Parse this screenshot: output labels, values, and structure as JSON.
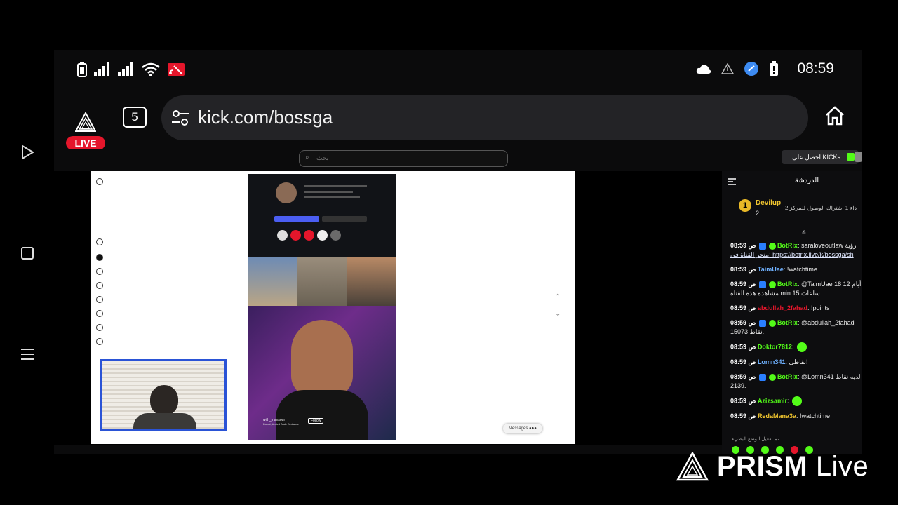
{
  "status_bar": {
    "time": "08:59",
    "left_icons": [
      "battery-icon",
      "signal-icon",
      "signal-icon-2",
      "wifi-icon",
      "cast-icon"
    ],
    "right_icons": [
      "cloud-icon",
      "warning-icon",
      "vpn-icon",
      "battery-icon-2"
    ]
  },
  "browser": {
    "live_label": "LIVE",
    "tab_count": "5",
    "url": "kick.com/bossga"
  },
  "kick": {
    "search_placeholder": "بحث",
    "get_kicks": "احصل على KICKs"
  },
  "chat": {
    "title": "الدردشة",
    "pinned": {
      "rank": "1",
      "name": "Devilup",
      "count": "2",
      "text": "داء 1 اشتراك الوصول للمركز 2"
    },
    "messages": [
      {
        "time": "08:59 ص",
        "user": "BotRix",
        "color": "#53fc18",
        "text": "saraloveoutlaw رؤية",
        "line2": "متجر القناة في: https://botrix.live/k/bossga/sh"
      },
      {
        "time": "08:59 ص",
        "user": "TaimUae",
        "color": "#6fb1ff",
        "text": "!watchtime",
        "line2": ""
      },
      {
        "time": "08:59 ص",
        "user": "BotRix",
        "color": "#53fc18",
        "text": "@TaimUae 18 أيام 12",
        "line2": "مشاهدة هذه القناة min ساعات 15."
      },
      {
        "time": "08:59 ص",
        "user": "abdullah_2fahad",
        "color": "#e5162b",
        "text": "!points",
        "line2": ""
      },
      {
        "time": "08:59 ص",
        "user": "BotRix",
        "color": "#53fc18",
        "text": "@abdullah_2fahad",
        "line2": "نقاط 15073."
      },
      {
        "time": "08:59 ص",
        "user": "Doktor7812",
        "color": "#53fc18",
        "text": "",
        "line2": ""
      },
      {
        "time": "08:59 ص",
        "user": "Lomn341",
        "color": "#6fb1ff",
        "text": "نقاطي!",
        "line2": ""
      },
      {
        "time": "08:59 ص",
        "user": "BotRix",
        "color": "#53fc18",
        "text": "@Lomn341 لديه نقاط",
        "line2": "2139."
      },
      {
        "time": "08:59 ص",
        "user": "Azizsamir",
        "color": "#53fc18",
        "text": "",
        "line2": ""
      },
      {
        "time": "08:59 ص",
        "user": "RedaMana3a",
        "color": "#f0c52f",
        "text": "!watchtime",
        "line2": ""
      }
    ],
    "footer_text": "تم تفعيل الوضع البطيء"
  },
  "reel": {
    "user": "with_mansour",
    "location": "Dubai, United Arab Emirates",
    "follow": "Follow"
  },
  "messages_chip": "Messages",
  "watermark": {
    "brand": "PRISM",
    "live": "Live"
  }
}
